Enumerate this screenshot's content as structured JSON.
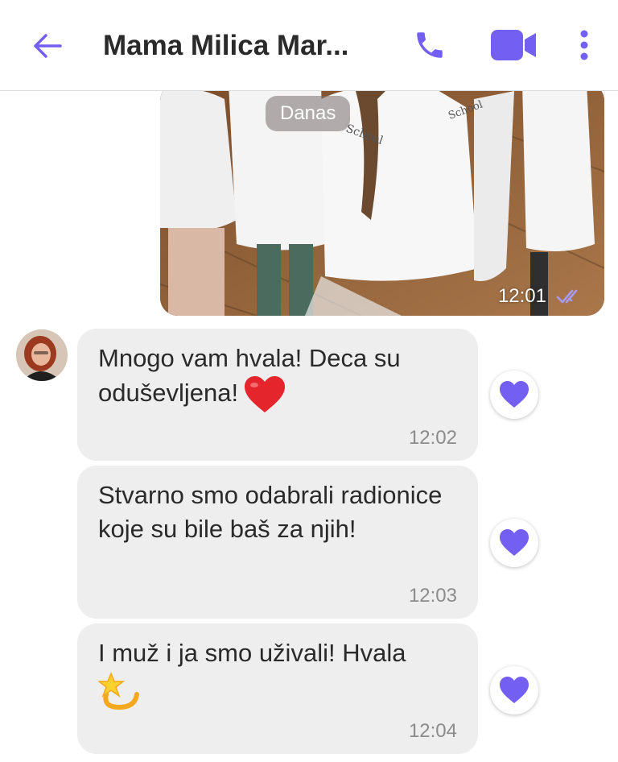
{
  "header": {
    "title": "Mama Milica Mar...",
    "back_icon": "arrow-left-icon",
    "call_icon": "phone-icon",
    "video_icon": "video-camera-icon",
    "more_icon": "more-vertical-icon"
  },
  "colors": {
    "accent": "#7360f2",
    "bubble": "#eeeeee",
    "time": "#8c8c8c"
  },
  "date_chip": "Danas",
  "photo_message": {
    "time": "12:01",
    "status_icon": "double-check-icon"
  },
  "messages": [
    {
      "text": "Mnogo vam hvala! Deca su oduševljena!",
      "emoji": "red-heart",
      "time": "12:02",
      "reaction_icon": "heart-icon"
    },
    {
      "text": "Stvarno smo odabrali radionice koje su bile baš za njih!",
      "time": "12:03",
      "reaction_icon": "heart-icon"
    },
    {
      "text": "I muž i ja smo uživali! Hvala",
      "emoji": "dizzy-star",
      "time": "12:04",
      "reaction_icon": "heart-icon"
    }
  ]
}
